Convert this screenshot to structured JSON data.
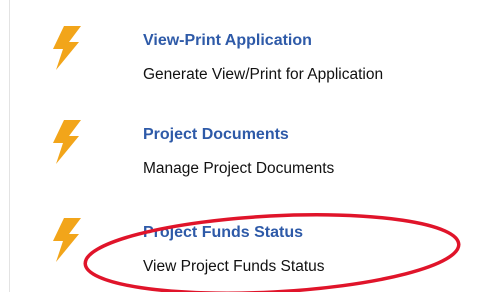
{
  "colors": {
    "link": "#2e5aa8",
    "icon": "#f2a51a",
    "highlight": "#e0142a"
  },
  "menu": {
    "items": [
      {
        "icon": "lightning-bolt-icon",
        "title": "View-Print Application",
        "description": "Generate View/Print for Application"
      },
      {
        "icon": "lightning-bolt-icon",
        "title": "Project Documents",
        "description": "Manage Project Documents"
      },
      {
        "icon": "lightning-bolt-icon",
        "title": "Project Funds Status",
        "description": "View Project Funds Status"
      }
    ]
  }
}
